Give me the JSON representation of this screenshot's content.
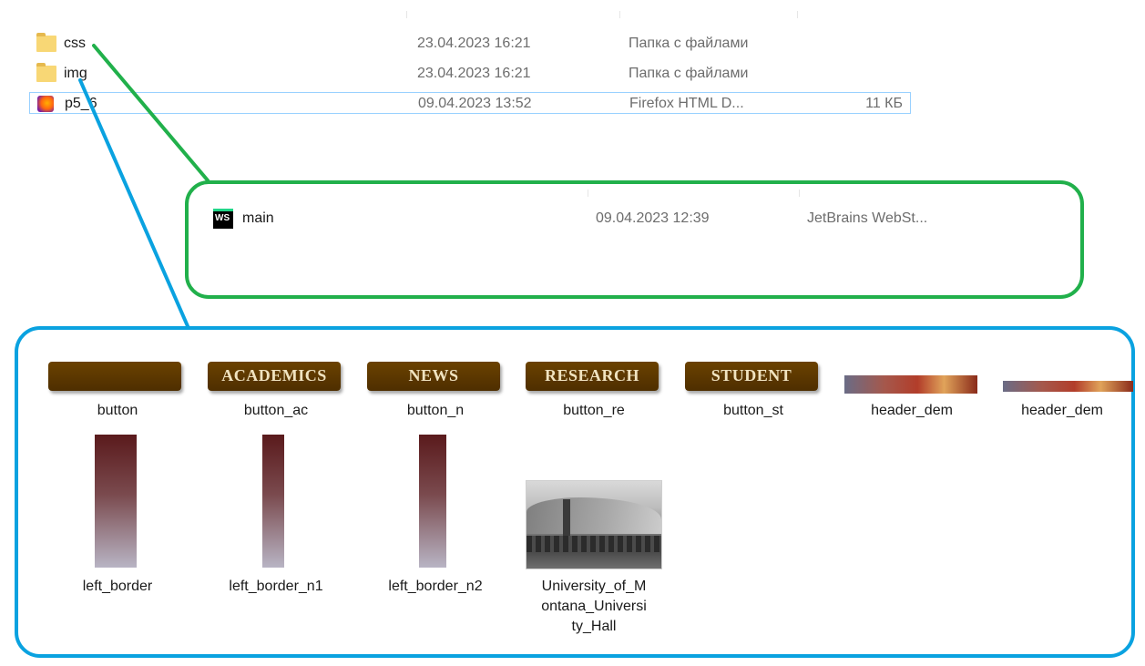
{
  "top_list": {
    "rows": [
      {
        "name": "css",
        "date": "23.04.2023 16:21",
        "type": "Папка с файлами",
        "size": "",
        "icon": "folder-icon"
      },
      {
        "name": "img",
        "date": "23.04.2023 16:21",
        "type": "Папка с файлами",
        "size": "",
        "icon": "folder-icon"
      },
      {
        "name": "p5_6",
        "date": "09.04.2023 13:52",
        "type": "Firefox HTML D...",
        "size": "11 КБ",
        "icon": "firefox-icon"
      }
    ]
  },
  "css_folder": {
    "rows": [
      {
        "name": "main",
        "date": "09.04.2023 12:39",
        "type": "JetBrains WebSt...",
        "icon": "webstorm-icon",
        "icon_text": "WS"
      }
    ]
  },
  "img_folder": {
    "buttons": [
      {
        "label": "",
        "caption": "button"
      },
      {
        "label": "ACADEMICS",
        "caption": "button_ac"
      },
      {
        "label": "NEWS",
        "caption": "button_n"
      },
      {
        "label": "RESEARCH",
        "caption": "button_re"
      },
      {
        "label": "STUDENT",
        "caption": "button_st"
      }
    ],
    "headers": [
      {
        "caption": "header_dem"
      },
      {
        "caption": "header_dem"
      }
    ],
    "borders": [
      {
        "caption": "left_border"
      },
      {
        "caption": "left_border_n1"
      },
      {
        "caption": "left_border_n2"
      }
    ],
    "photo": {
      "caption_lines": [
        "University_of_M",
        "ontana_Universi",
        "ty_Hall"
      ]
    }
  },
  "colors": {
    "green_frame": "#21b04b",
    "blue_frame": "#0aa2e0",
    "selection": "#99d1ff"
  }
}
